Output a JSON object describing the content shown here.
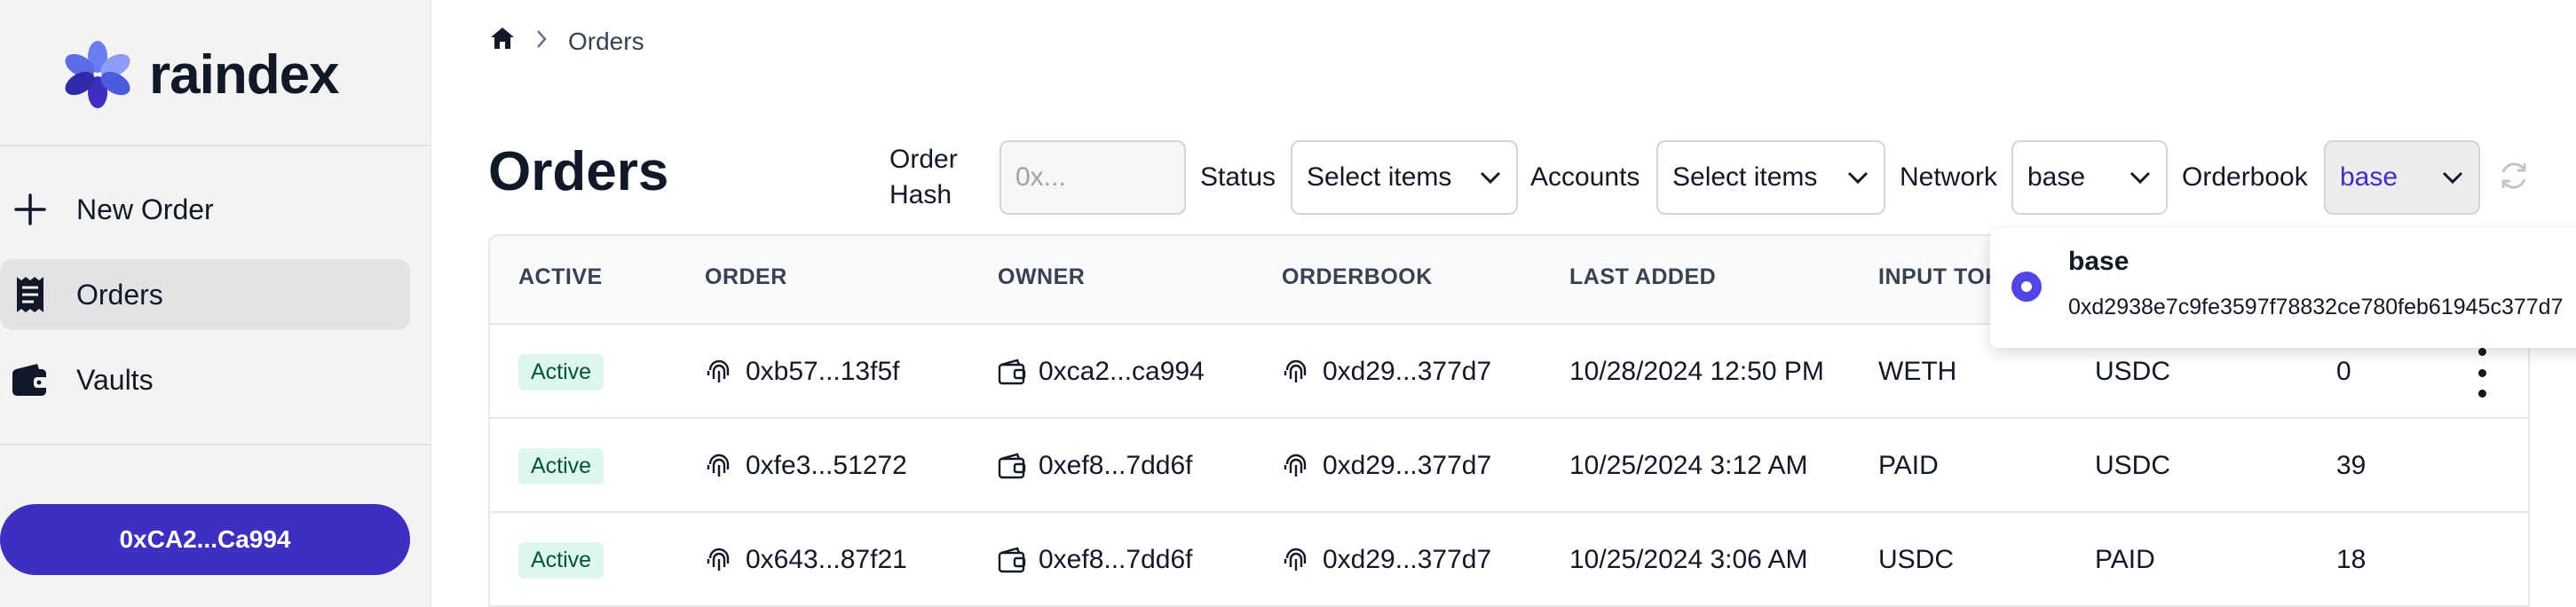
{
  "app": {
    "name": "raindex"
  },
  "sidebar": {
    "items": [
      {
        "label": "New Order",
        "icon": "plus-icon"
      },
      {
        "label": "Orders",
        "icon": "receipt-icon"
      },
      {
        "label": "Vaults",
        "icon": "wallet-icon"
      }
    ],
    "wallet_label": "0xCA2...Ca994"
  },
  "breadcrumb": {
    "home_icon": "home-icon",
    "current": "Orders"
  },
  "page": {
    "title": "Orders"
  },
  "filters": {
    "order_hash": {
      "label": "Order Hash",
      "placeholder": "0x..."
    },
    "status": {
      "label": "Status",
      "value": "Select items"
    },
    "accounts": {
      "label": "Accounts",
      "value": "Select items"
    },
    "network": {
      "label": "Network",
      "value": "base"
    },
    "orderbook": {
      "label": "Orderbook",
      "value": "base"
    }
  },
  "table": {
    "headers": [
      "ACTIVE",
      "ORDER",
      "OWNER",
      "ORDERBOOK",
      "LAST ADDED",
      "INPUT TOKENS"
    ],
    "rows": [
      {
        "status": "Active",
        "order": "0xb57...13f5f",
        "owner": "0xca2...ca994",
        "orderbook": "0xd29...377d7",
        "last_added": "10/28/2024 12:50 PM",
        "input": "WETH",
        "output": "USDC",
        "trades": "0"
      },
      {
        "status": "Active",
        "order": "0xfe3...51272",
        "owner": "0xef8...7dd6f",
        "orderbook": "0xd29...377d7",
        "last_added": "10/25/2024 3:12 AM",
        "input": "PAID",
        "output": "USDC",
        "trades": "39"
      },
      {
        "status": "Active",
        "order": "0x643...87f21",
        "owner": "0xef8...7dd6f",
        "orderbook": "0xd29...377d7",
        "last_added": "10/25/2024 3:06 AM",
        "input": "USDC",
        "output": "PAID",
        "trades": "18"
      }
    ]
  },
  "dropdown": {
    "option": {
      "name": "base",
      "address": "0xd2938e7c9fe3597f78832ce780feb61945c377d7"
    }
  },
  "colors": {
    "brand": "#3f2fc1",
    "active_badge_bg": "#def7ec",
    "active_badge_text": "#03543f"
  }
}
